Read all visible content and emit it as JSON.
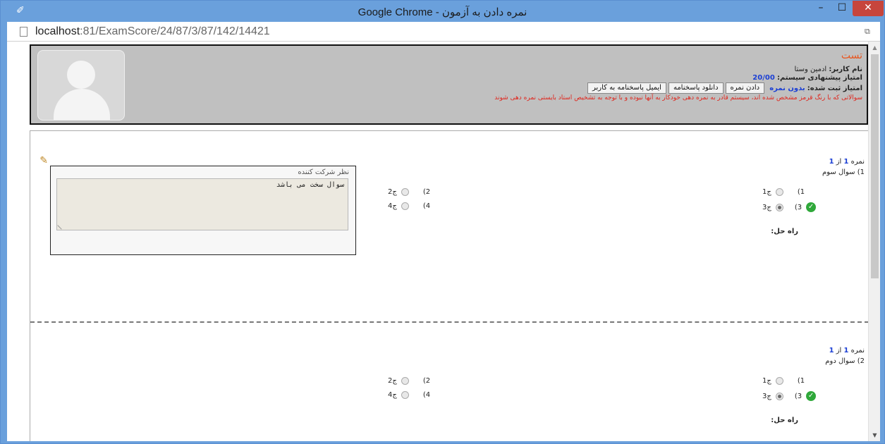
{
  "window": {
    "title": "نمره دادن به آزمون - Google Chrome",
    "minimize": "–",
    "maximize": "☐",
    "close": "✕"
  },
  "address": {
    "host": "localhost",
    "path": ":81/ExamScore/24/87/3/87/142/14421"
  },
  "header": {
    "title": "تست",
    "username_label": "نام کاربر:",
    "username": "ادمین وستا",
    "suggested_label": "امتیاز پیشنهادی سیستم:",
    "suggested_value": "20/00",
    "recorded_label": "امتیاز ثبت شده:",
    "recorded_value": "بدون نمره",
    "buttons": {
      "give_score": "دادن نمره",
      "download_answers": "دانلود پاسخنامه",
      "email_answers": "ایمیل پاسخنامه به کاربر"
    },
    "note": "سوالاتی که با رنگ قرمز مشخص شده اند، سیستم قادر به نمره دهی خودکار به آنها نبوده و با توجه به تشخیص استاد بایستی نمره دهی شوند"
  },
  "questions": [
    {
      "score_prefix": "نمره",
      "score": "1",
      "of": "از",
      "total": "1",
      "title": "1) سوال سوم",
      "options": [
        "(1",
        "(2",
        "(3",
        "(4"
      ],
      "option_labels": [
        "ج1",
        "ج2",
        "ج3",
        "ج4"
      ],
      "selected_index": 2,
      "correct_index": 2,
      "solution_label": "راه حل:",
      "comment_label": "نظر شرکت کننده",
      "comment_text": "سوال سخت می باشد"
    },
    {
      "score_prefix": "نمره",
      "score": "1",
      "of": "از",
      "total": "1",
      "title": "2) سوال دوم",
      "options": [
        "(1",
        "(2",
        "(3",
        "(4"
      ],
      "option_labels": [
        "ج1",
        "ج2",
        "ج3",
        "ج4"
      ],
      "selected_index": 2,
      "correct_index": 2,
      "solution_label": "راه حل:"
    }
  ],
  "icons": {
    "app": "chrome-app-icon",
    "page": "page-icon",
    "extension": "extension-icon",
    "edit": "pencil-icon",
    "correct": "check-icon"
  },
  "colors": {
    "accent_blue": "#1b3fd4",
    "title_orange": "#e8551e",
    "note_red": "#e0241b",
    "correct_green": "#2fa83a",
    "header_bg": "#c0c0c0"
  }
}
